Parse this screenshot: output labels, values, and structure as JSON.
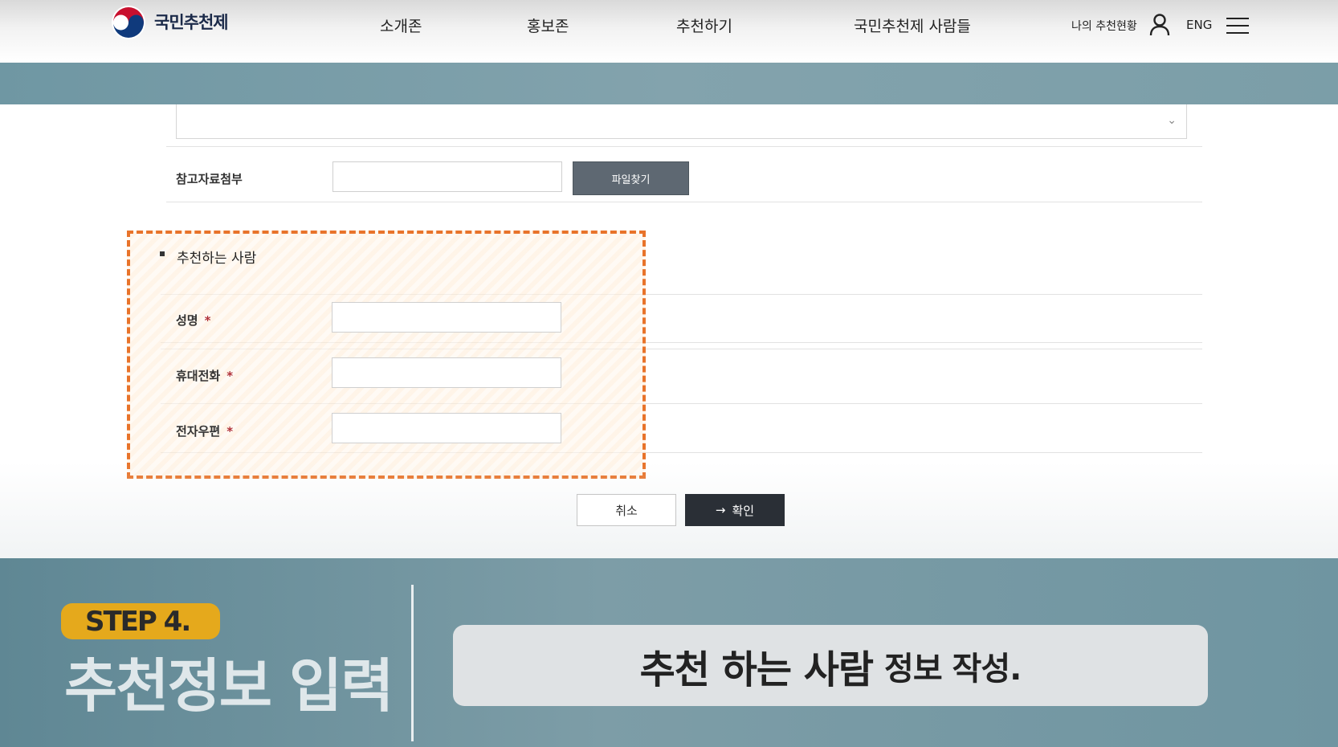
{
  "header": {
    "logo_text": "국민추천제",
    "nav": [
      "소개존",
      "홍보존",
      "추천하기",
      "국민추천제 사람들"
    ],
    "my_status": "나의 추천현황",
    "lang": "ENG"
  },
  "form": {
    "attachment_label": "참고자료첨부",
    "file_button": "파일찾기",
    "recommender_section_title": "추천하는 사람",
    "fields": [
      {
        "label": "성명",
        "required": "*"
      },
      {
        "label": "휴대전화",
        "required": "*"
      },
      {
        "label": "전자우편",
        "required": "*"
      }
    ],
    "cancel_label": "취소",
    "confirm_label": "확인",
    "confirm_arrow": "→"
  },
  "caption": {
    "step": "STEP 4.",
    "title": "추천정보 입력",
    "main": "추천 하는 사람",
    "sub": "정보 작성."
  },
  "colors": {
    "highlight_border": "#e8732a",
    "step_pill": "#e5a91c",
    "confirm_button": "#2a2f36",
    "file_button": "#5e6872",
    "band": "#7b9ea8"
  }
}
